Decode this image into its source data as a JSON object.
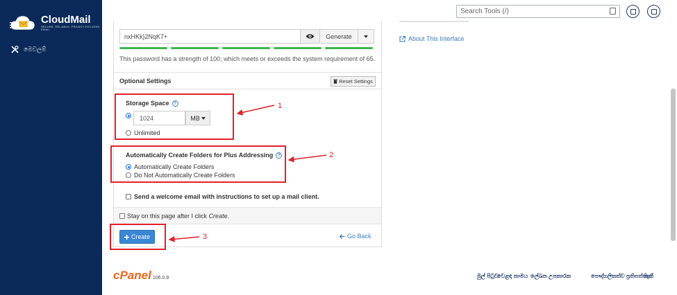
{
  "brand": {
    "name": "CloudMail",
    "tagline": "SECURE, RELIABLE, PRIVACY-FOCUSED EMAIL"
  },
  "sidebar": {
    "items": [
      {
        "label": "මෙවලම්",
        "icon": "tools-icon"
      }
    ]
  },
  "header": {
    "search_placeholder": "Search Tools (/)",
    "buttons": [
      "user-icon",
      "notifications-icon"
    ]
  },
  "password": {
    "value": "nxHKk}2NqK7+",
    "generate_label": "Generate",
    "strength_message": "This password has a strength of 100, which meets or exceeds the system requirement of 65.",
    "strength_percent": 100,
    "strength_color": "#3cb64b"
  },
  "optional": {
    "title": "Optional Settings",
    "reset_label": "Reset Settings"
  },
  "storage": {
    "title": "Storage Space",
    "quota_value": "1024",
    "unit": "MB",
    "unlimited_label": "Unlimited",
    "selected": "quota"
  },
  "plus_addressing": {
    "title": "Automatically Create Folders for Plus Addressing",
    "option_auto": "Automatically Create Folders",
    "option_none": "Do Not Automatically Create Folders",
    "selected": "auto"
  },
  "welcome": {
    "label": "Send a welcome email with instructions to set up a mail client.",
    "checked": false
  },
  "stay": {
    "prefix": "Stay on this page after I click ",
    "emphasis": "Create",
    "suffix": ".",
    "checked": false
  },
  "actions": {
    "create_label": "Create",
    "go_back_label": "Go Back"
  },
  "right": {
    "about_label": "About This Interface"
  },
  "annotations": [
    "1",
    "2",
    "3"
  ],
  "footer": {
    "logo": "cPanel",
    "version": "106.0.9",
    "links": [
      "මුල් පිටුව",
      "වෙළඳ නාමය",
      "ලේඛන",
      "උපකාරක",
      "පෞද්ගලිකත්ව ප්‍රතිපත්තිය",
      "කුකී"
    ]
  },
  "colors": {
    "sidebar": "#0b2a59",
    "accent": "#3a87d4",
    "annotation": "#e0202a",
    "cpanel": "#e8681f"
  }
}
